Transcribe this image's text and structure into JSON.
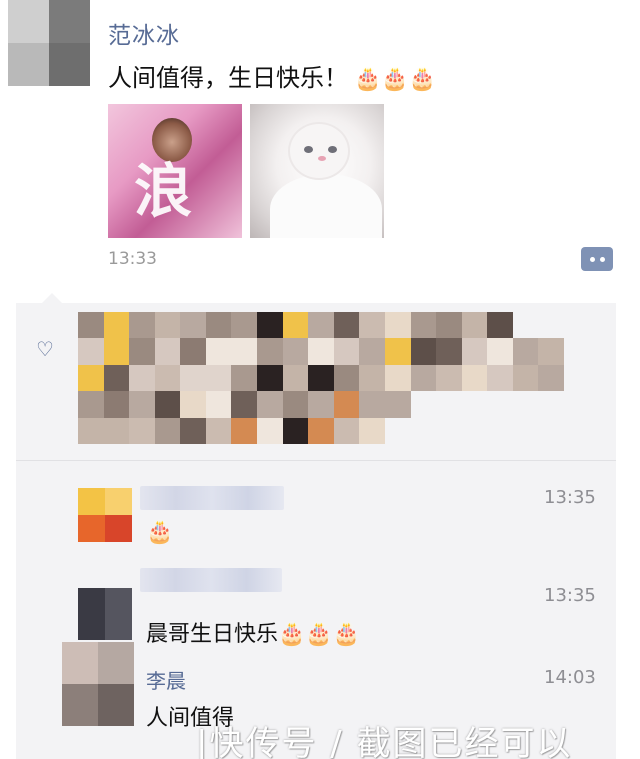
{
  "post": {
    "author_name": "范冰冰",
    "text": "人间值得，生日快乐！",
    "text_emoji": "🎂🎂🎂",
    "time": "13:33"
  },
  "likes": {
    "heart_icon": "heart-icon"
  },
  "comments": [
    {
      "text": "🎂",
      "time": "13:35"
    },
    {
      "text": "晨哥生日快乐🎂🎂🎂",
      "time": "13:35"
    },
    {
      "name": "李晨",
      "text": "人间值得",
      "time": "14:03"
    }
  ],
  "watermark": "|快传号 / 截图已经可以",
  "colors": {
    "name_link": "#576b95",
    "comment_bg": "#f3f3f5",
    "time_gray": "#9a9a9a",
    "comment_button": "#7f92b5"
  }
}
